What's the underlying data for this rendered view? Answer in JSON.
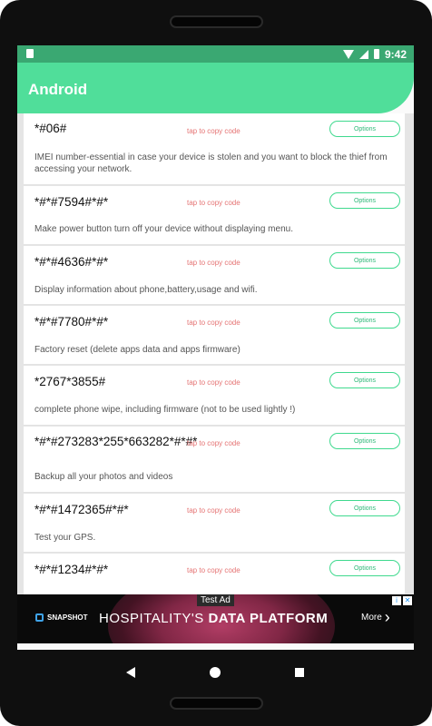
{
  "status_bar": {
    "time": "9:42"
  },
  "app_bar": {
    "title": "Android"
  },
  "items": [
    {
      "code": "*#06#",
      "tap_label": "tap to copy code",
      "options_label": "Options",
      "description": "IMEI number-essential in case your device is stolen and you want to block the thief from accessing your network."
    },
    {
      "code": "*#*#7594#*#*",
      "tap_label": "tap to copy code",
      "options_label": "Options",
      "description": "Make power button turn off your device without displaying menu."
    },
    {
      "code": "*#*#4636#*#*",
      "tap_label": "tap to copy code",
      "options_label": "Options",
      "description": "Display information about phone,battery,usage and wifi."
    },
    {
      "code": "*#*#7780#*#*",
      "tap_label": "tap to copy code",
      "options_label": "Options",
      "description": "Factory reset (delete apps data and apps firmware)"
    },
    {
      "code": "*2767*3855#",
      "tap_label": "tap to copy code",
      "options_label": "Options",
      "description": "complete phone wipe, including firmware (not to be used lightly !)"
    },
    {
      "code": "*#*#273283*255*663282*#*#*",
      "tap_label": "tap to copy code",
      "options_label": "Options",
      "description": "Backup all your photos and videos"
    },
    {
      "code": "*#*#1472365#*#*",
      "tap_label": "tap to copy code",
      "options_label": "Options",
      "description": "Test your GPS."
    },
    {
      "code": "*#*#1234#*#*",
      "tap_label": "tap to copy code",
      "options_label": "Options",
      "description": ""
    }
  ],
  "ad": {
    "label": "Test Ad",
    "brand": "SNAPSHOT",
    "headline_prefix": "HOSPITALITY'S",
    "headline_bold": "DATA PLATFORM",
    "more": "More"
  },
  "colors": {
    "status_bar": "#3aa872",
    "app_bar": "#50de9a",
    "accent": "#3fd98e",
    "tap_text": "#e57373"
  }
}
